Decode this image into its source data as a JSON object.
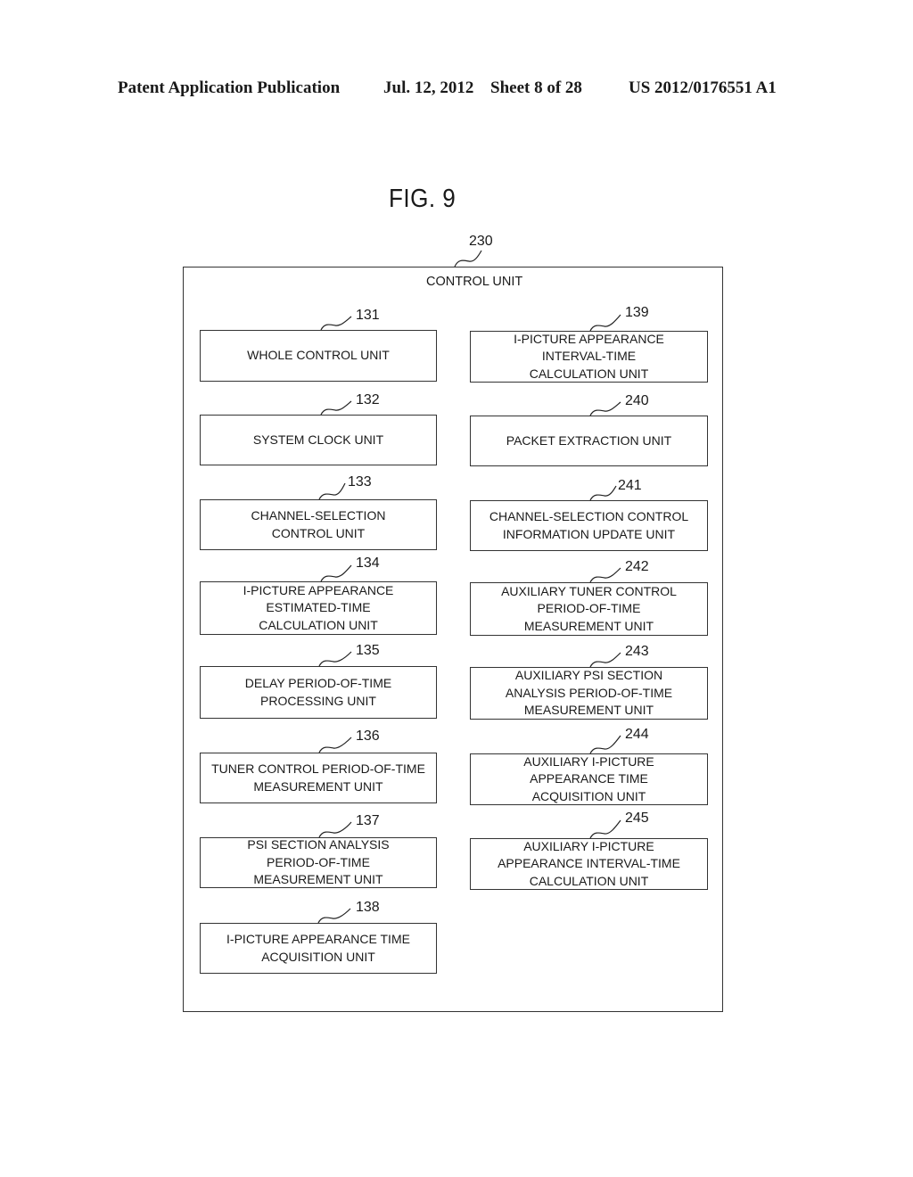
{
  "header": {
    "publication": "Patent Application Publication",
    "date": "Jul. 12, 2012",
    "sheet": "Sheet 8 of 28",
    "number": "US 2012/0176551 A1"
  },
  "figure": {
    "title": "FIG. 9",
    "outer": {
      "ref": "230",
      "label": "CONTROL UNIT"
    },
    "left_units": [
      {
        "ref": "131",
        "label": "WHOLE CONTROL UNIT"
      },
      {
        "ref": "132",
        "label": "SYSTEM CLOCK UNIT"
      },
      {
        "ref": "133",
        "label": "CHANNEL-SELECTION\nCONTROL UNIT"
      },
      {
        "ref": "134",
        "label": "I-PICTURE APPEARANCE\nESTIMATED-TIME\nCALCULATION UNIT"
      },
      {
        "ref": "135",
        "label": "DELAY PERIOD-OF-TIME\nPROCESSING UNIT"
      },
      {
        "ref": "136",
        "label": "TUNER CONTROL PERIOD-OF-TIME\nMEASUREMENT UNIT"
      },
      {
        "ref": "137",
        "label": "PSI SECTION ANALYSIS\nPERIOD-OF-TIME\nMEASUREMENT UNIT"
      },
      {
        "ref": "138",
        "label": "I-PICTURE APPEARANCE TIME\nACQUISITION UNIT"
      }
    ],
    "right_units": [
      {
        "ref": "139",
        "label": "I-PICTURE APPEARANCE\nINTERVAL-TIME\nCALCULATION UNIT"
      },
      {
        "ref": "240",
        "label": "PACKET EXTRACTION UNIT"
      },
      {
        "ref": "241",
        "label": "CHANNEL-SELECTION CONTROL\nINFORMATION UPDATE UNIT"
      },
      {
        "ref": "242",
        "label": "AUXILIARY TUNER CONTROL\nPERIOD-OF-TIME\nMEASUREMENT UNIT"
      },
      {
        "ref": "243",
        "label": "AUXILIARY PSI SECTION\nANALYSIS PERIOD-OF-TIME\nMEASUREMENT UNIT"
      },
      {
        "ref": "244",
        "label": "AUXILIARY I-PICTURE\nAPPEARANCE TIME\nACQUISITION UNIT"
      },
      {
        "ref": "245",
        "label": "AUXILIARY I-PICTURE\nAPPEARANCE INTERVAL-TIME\nCALCULATION UNIT"
      }
    ]
  }
}
